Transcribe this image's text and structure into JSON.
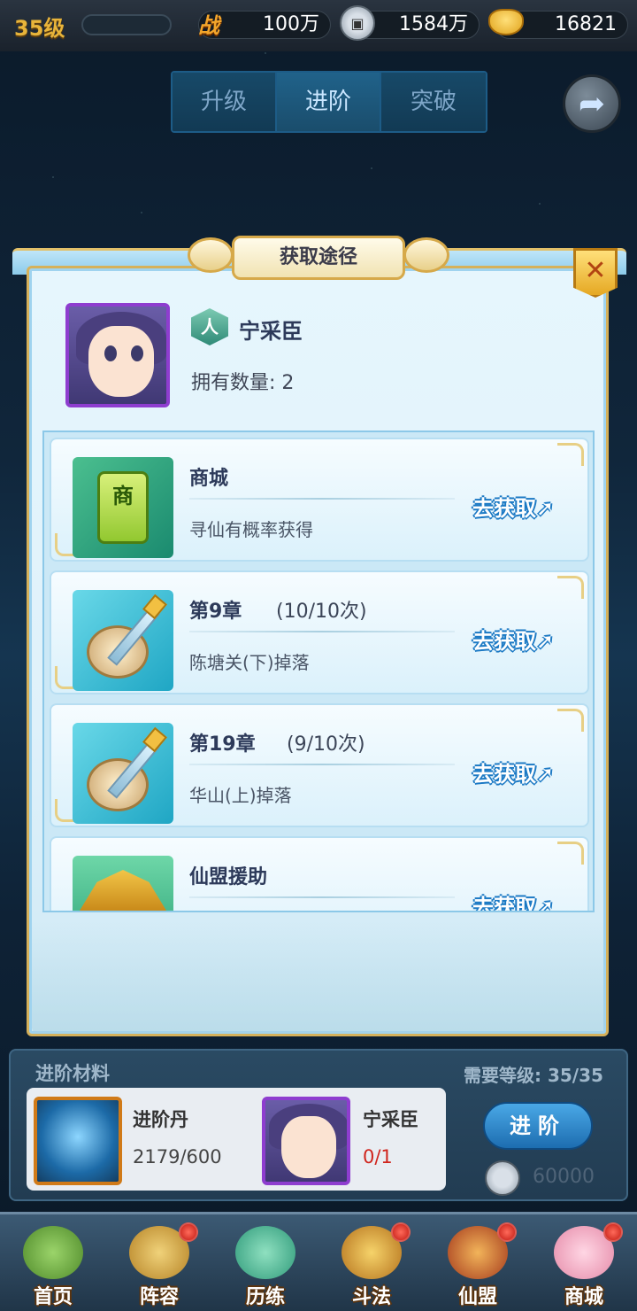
{
  "topbar": {
    "level": "35级",
    "power_icon_text": "战",
    "power": "100万",
    "coins": "1584万",
    "ingots": "16821"
  },
  "tabs": [
    {
      "label": "升级",
      "active": false
    },
    {
      "label": "进阶",
      "active": true
    },
    {
      "label": "突破",
      "active": false
    }
  ],
  "modal": {
    "title": "获取途径",
    "close_icon": "close-icon",
    "hero": {
      "type_icon_text": "人",
      "name": "宁采臣",
      "owned": "拥有数量: 2"
    },
    "sources": [
      {
        "icon": "shop-card-icon",
        "icon_text": "商",
        "title": "商城",
        "count": "",
        "desc": "寻仙有概率获得",
        "action": "去获取"
      },
      {
        "icon": "sword-disc-icon",
        "title": "第9章",
        "count": "(10/10次)",
        "desc": "陈塘关(下)掉落",
        "action": "去获取"
      },
      {
        "icon": "sword-disc-icon",
        "title": "第19章",
        "count": "(9/10次)",
        "desc": "华山(上)掉落",
        "action": "去获取"
      },
      {
        "icon": "guild-hall-icon",
        "title": "仙盟援助",
        "count": "",
        "desc": "",
        "action": "去获取"
      }
    ]
  },
  "materials": {
    "label": "进阶材料",
    "need_level": "需要等级: 35/35",
    "items": [
      {
        "name": "进阶丹",
        "count": "2179/600"
      },
      {
        "name": "宁采臣",
        "count": "0/1"
      }
    ],
    "advance_button": "进阶",
    "cost": "60000"
  },
  "nav": [
    {
      "label": "首页",
      "badge": false
    },
    {
      "label": "阵容",
      "badge": true
    },
    {
      "label": "历练",
      "badge": false
    },
    {
      "label": "斗法",
      "badge": true
    },
    {
      "label": "仙盟",
      "badge": true
    },
    {
      "label": "商城",
      "badge": true
    }
  ],
  "colors": {
    "accent_gold": "#e8b43a",
    "button_blue": "#1d6db0",
    "warning_red": "#d0241c"
  }
}
